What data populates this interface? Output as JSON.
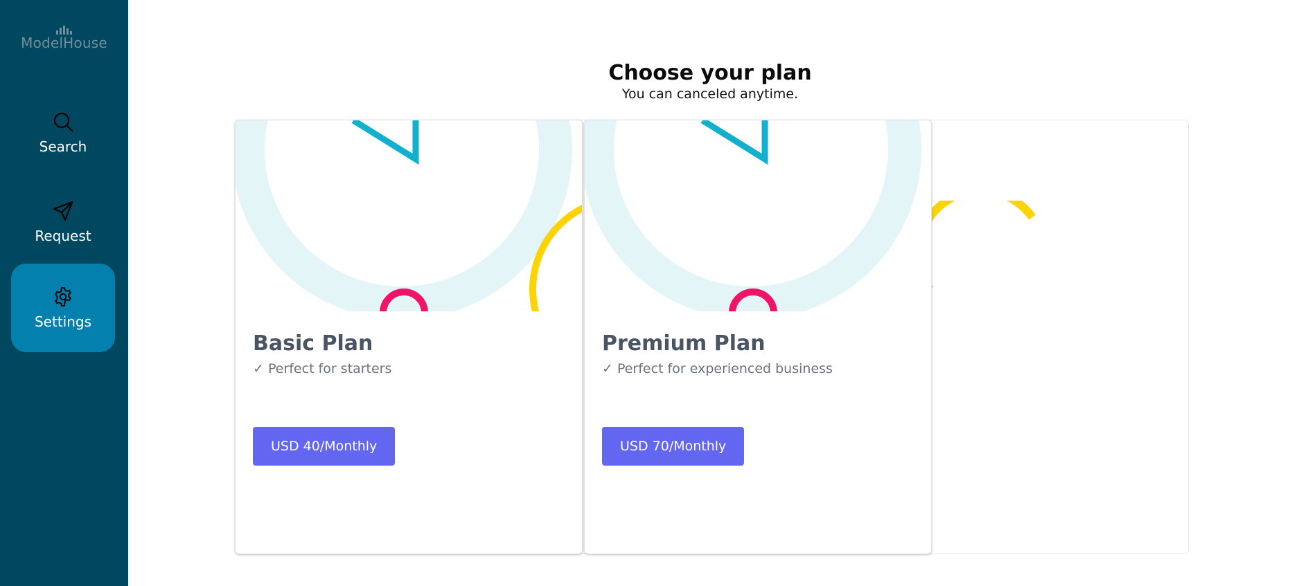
{
  "brand": {
    "name": "ModelHouse"
  },
  "sidebar": {
    "items": [
      {
        "label": "Search",
        "icon": "search-icon"
      },
      {
        "label": "Request",
        "icon": "paper-plane-icon"
      },
      {
        "label": "Settings",
        "icon": "gear-icon",
        "active": true
      }
    ]
  },
  "header": {
    "title": "Choose your plan",
    "subtitle": "You can canceled anytime."
  },
  "plans": [
    {
      "name": "Basic Plan",
      "feature": "✓ Perfect for starters",
      "price_label": "USD 40/Monthly"
    },
    {
      "name": "Premium Plan",
      "feature": "✓ Perfect for experienced business",
      "price_label": "USD 70/Monthly"
    }
  ],
  "colors": {
    "sidebar_bg": "#024760",
    "active_nav": "#0480ae",
    "button": "#6366f1",
    "art_ring": "#e3f5f7",
    "art_triangle": "#12b0cf",
    "art_pink": "#f0136a",
    "art_yellow": "#fcd304"
  }
}
